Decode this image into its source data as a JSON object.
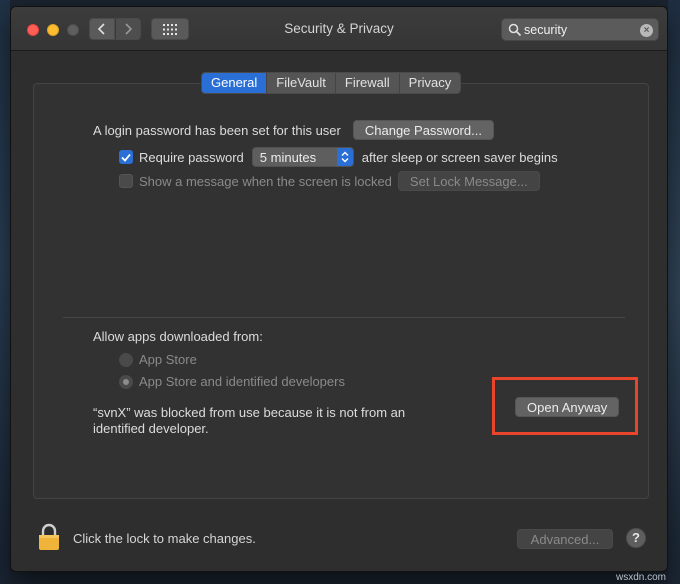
{
  "window": {
    "title": "Security & Privacy"
  },
  "search": {
    "value": "security"
  },
  "tabs": [
    {
      "label": "General",
      "active": true
    },
    {
      "label": "FileVault",
      "active": false
    },
    {
      "label": "Firewall",
      "active": false
    },
    {
      "label": "Privacy",
      "active": false
    }
  ],
  "general": {
    "login_text": "A login password has been set for this user",
    "change_password_label": "Change Password...",
    "require_password_label": "Require password",
    "require_password_checked": true,
    "require_password_delay": "5 minutes",
    "after_sleep_text": "after sleep or screen saver begins",
    "show_message_label": "Show a message when the screen is locked",
    "show_message_checked": false,
    "set_lock_message_label": "Set Lock Message..."
  },
  "apps": {
    "heading": "Allow apps downloaded from:",
    "options": [
      {
        "label": "App Store",
        "selected": false
      },
      {
        "label": "App Store and identified developers",
        "selected": true
      }
    ],
    "blocked_message": "“svnX” was blocked from use because it is not from an identified developer.",
    "open_anyway_label": "Open Anyway",
    "highlight_color": "#e8452c"
  },
  "footer": {
    "lock_text": "Click the lock to make changes.",
    "advanced_label": "Advanced...",
    "help_label": "?"
  },
  "watermark": "wsxdn.com",
  "colors": {
    "accent": "#2a6fd6",
    "lock": "#f0b43a"
  }
}
